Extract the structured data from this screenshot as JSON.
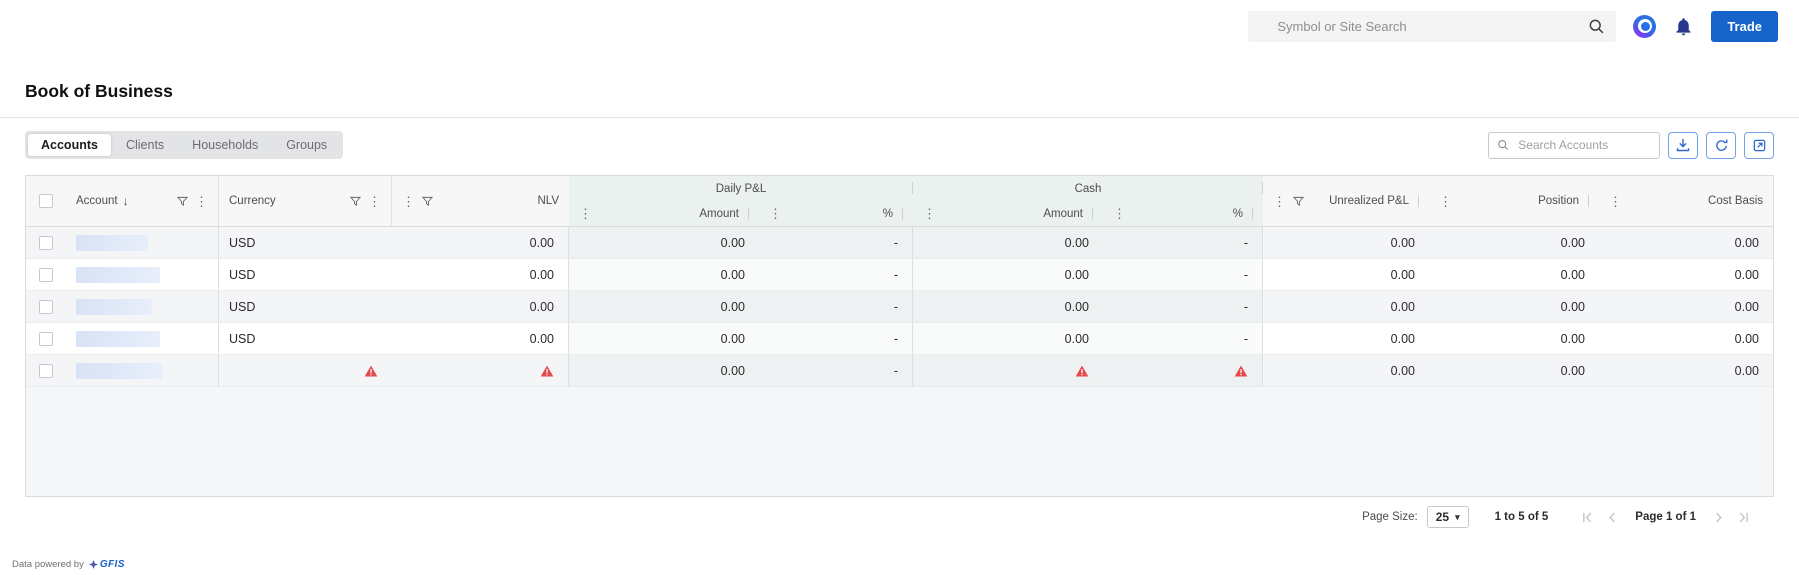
{
  "topbar": {
    "search_placeholder": "Symbol or Site Search",
    "trade_label": "Trade"
  },
  "page_title": "Book of Business",
  "tabs": {
    "accounts": "Accounts",
    "clients": "Clients",
    "households": "Households",
    "groups": "Groups"
  },
  "toolbar": {
    "search_placeholder": "Search Accounts"
  },
  "grid": {
    "group_headers": {
      "daily_pl": "Daily P&L",
      "cash": "Cash"
    },
    "columns": {
      "account": "Account",
      "currency": "Currency",
      "nlv": "NLV",
      "amount": "Amount",
      "percent": "%",
      "unrealized_pl": "Unrealized P&L",
      "position": "Position",
      "cost_basis": "Cost Basis"
    },
    "rows": [
      {
        "currency": "USD",
        "nlv": "0.00",
        "daily_amount": "0.00",
        "daily_percent": "-",
        "cash_amount": "0.00",
        "cash_percent": "-",
        "unrealized_pl": "0.00",
        "position": "0.00",
        "cost_basis": "0.00"
      },
      {
        "currency": "USD",
        "nlv": "0.00",
        "daily_amount": "0.00",
        "daily_percent": "-",
        "cash_amount": "0.00",
        "cash_percent": "-",
        "unrealized_pl": "0.00",
        "position": "0.00",
        "cost_basis": "0.00"
      },
      {
        "currency": "USD",
        "nlv": "0.00",
        "daily_amount": "0.00",
        "daily_percent": "-",
        "cash_amount": "0.00",
        "cash_percent": "-",
        "unrealized_pl": "0.00",
        "position": "0.00",
        "cost_basis": "0.00"
      },
      {
        "currency": "USD",
        "nlv": "0.00",
        "daily_amount": "0.00",
        "daily_percent": "-",
        "cash_amount": "0.00",
        "cash_percent": "-",
        "unrealized_pl": "0.00",
        "position": "0.00",
        "cost_basis": "0.00"
      },
      {
        "daily_amount": "0.00",
        "daily_percent": "-",
        "unrealized_pl": "0.00",
        "position": "0.00",
        "cost_basis": "0.00",
        "warnings": [
          "currency",
          "nlv",
          "cash_amount",
          "cash_percent"
        ]
      }
    ]
  },
  "pager": {
    "page_size_label": "Page Size:",
    "page_size_value": "25",
    "range_text": "1 to 5 of 5",
    "page_text": "Page 1 of 1"
  },
  "footer": {
    "powered_by": "Data powered by",
    "brand": "GFIS"
  },
  "icons": {
    "kebab": "⋮",
    "sort_desc": "↓",
    "dropdown": "▾"
  },
  "colors": {
    "accent_blue": "#1663c9",
    "warning_red": "#e5494d",
    "group_tint": "#eaf1ee",
    "row_stripe": "#f4f5f7"
  }
}
